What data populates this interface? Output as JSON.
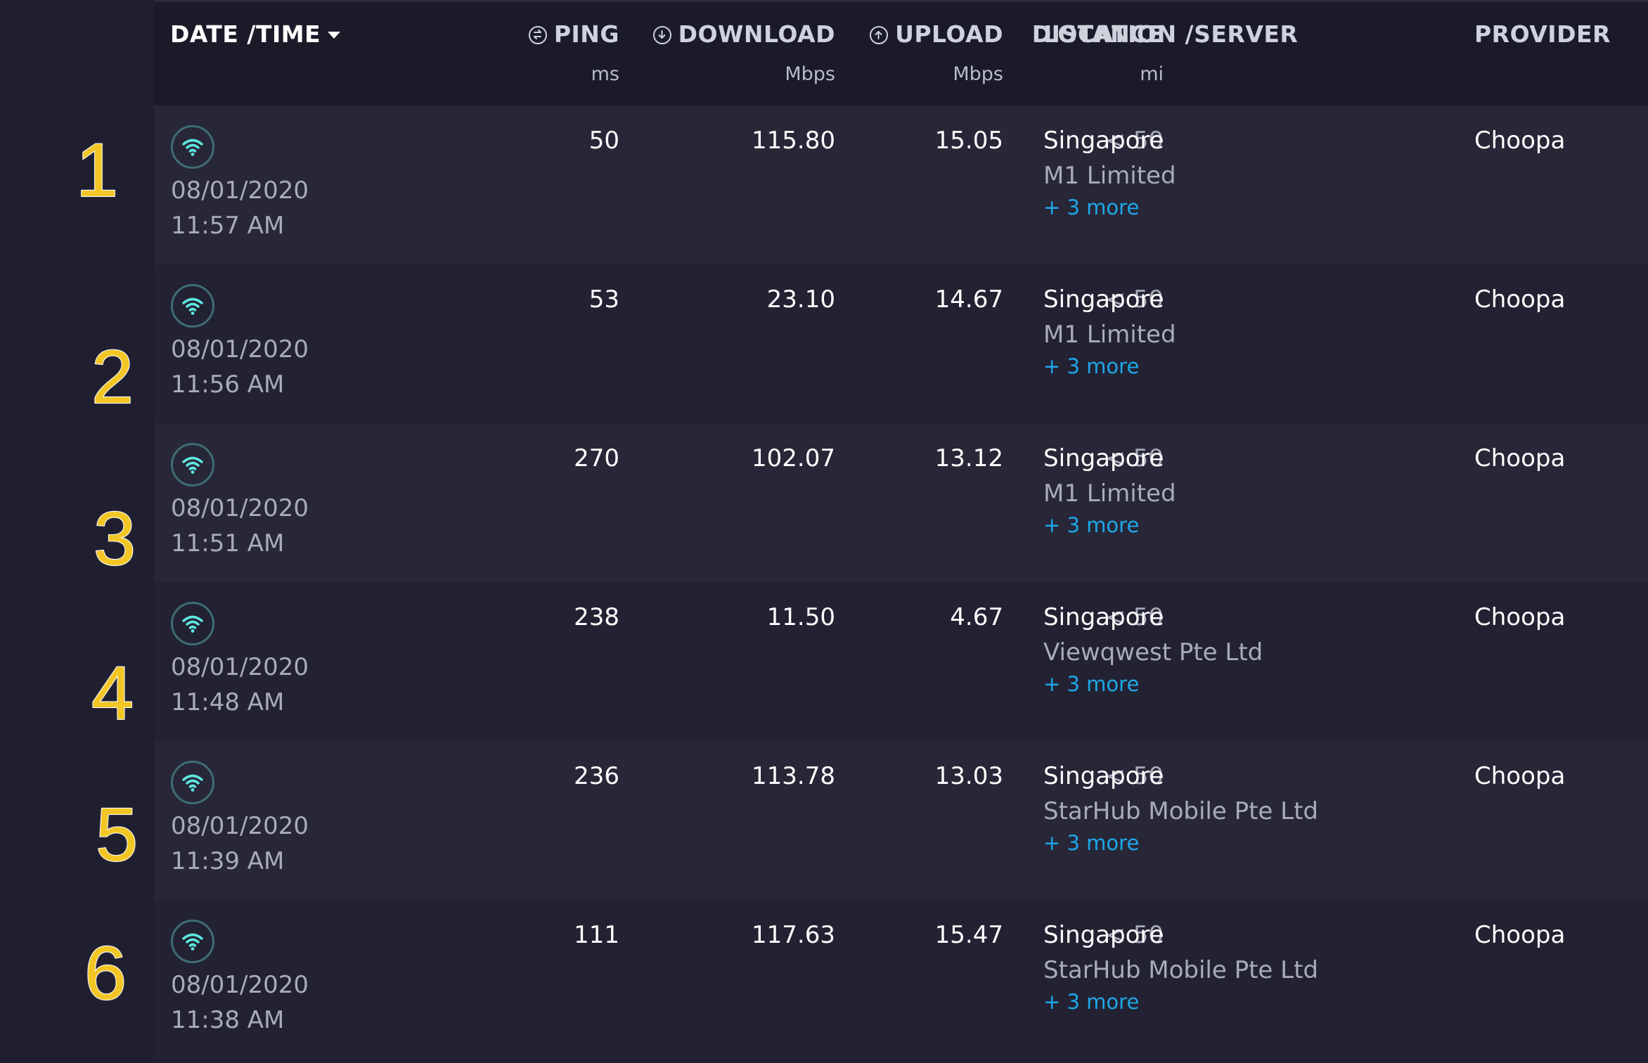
{
  "header": {
    "date_time": "DATE /TIME",
    "ping": "PING",
    "ping_unit": "ms",
    "download": "DOWNLOAD",
    "download_unit": "Mbps",
    "upload": "UPLOAD",
    "upload_unit": "Mbps",
    "distance": "DISTANCE",
    "distance_unit": "mi",
    "location_server": "LOCATION /SERVER",
    "provider": "PROVIDER"
  },
  "icons": {
    "connection": "wifi-icon",
    "ping": "ping-icon",
    "download": "download-icon",
    "upload": "upload-icon",
    "sort": "caret-down-icon"
  },
  "colors": {
    "background": "#1f1f30",
    "wifi": "#5ee7e0",
    "link": "#1ea7e8",
    "rank_badge": "#f2c624"
  },
  "rows": [
    {
      "rank": "1",
      "date": "08/01/2020",
      "time": "11:57 AM",
      "ping": "50",
      "download": "115.80",
      "upload": "15.05",
      "distance": "< 50",
      "location": "Singapore",
      "server": "M1 Limited",
      "more": "+ 3 more",
      "provider": "Choopa"
    },
    {
      "rank": "2",
      "date": "08/01/2020",
      "time": "11:56 AM",
      "ping": "53",
      "download": "23.10",
      "upload": "14.67",
      "distance": "< 50",
      "location": "Singapore",
      "server": "M1 Limited",
      "more": "+ 3 more",
      "provider": "Choopa"
    },
    {
      "rank": "3",
      "date": "08/01/2020",
      "time": "11:51 AM",
      "ping": "270",
      "download": "102.07",
      "upload": "13.12",
      "distance": "< 50",
      "location": "Singapore",
      "server": "M1 Limited",
      "more": "+ 3 more",
      "provider": "Choopa"
    },
    {
      "rank": "4",
      "date": "08/01/2020",
      "time": "11:48 AM",
      "ping": "238",
      "download": "11.50",
      "upload": "4.67",
      "distance": "< 50",
      "location": "Singapore",
      "server": "Viewqwest Pte Ltd",
      "more": "+ 3 more",
      "provider": "Choopa"
    },
    {
      "rank": "5",
      "date": "08/01/2020",
      "time": "11:39 AM",
      "ping": "236",
      "download": "113.78",
      "upload": "13.03",
      "distance": "< 50",
      "location": "Singapore",
      "server": "StarHub Mobile Pte Ltd",
      "more": "+ 3 more",
      "provider": "Choopa"
    },
    {
      "rank": "6",
      "date": "08/01/2020",
      "time": "11:38 AM",
      "ping": "111",
      "download": "117.63",
      "upload": "15.47",
      "distance": "< 50",
      "location": "Singapore",
      "server": "StarHub Mobile Pte Ltd",
      "more": "+ 3 more",
      "provider": "Choopa"
    }
  ]
}
